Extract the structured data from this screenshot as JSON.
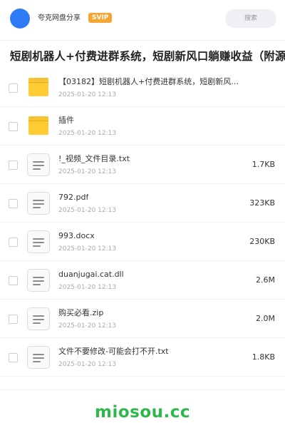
{
  "colors": {
    "accent": "#2f7bf5",
    "badge": "#f7a532",
    "brand_green": "#2cb84a"
  },
  "header": {
    "app_name": "夸克网盘分享",
    "badge": "SVIP",
    "search_placeholder": "搜索"
  },
  "title": "短剧机器人+付费进群系统，短剧新风口躺赚收益（附源码",
  "files": [
    {
      "name": "【03182】短剧机器人+付费进群系统，短剧新风口…",
      "date": "2025-01-20 12:13",
      "size": "",
      "icon": "folder-icon"
    },
    {
      "name": "插件",
      "date": "2025-01-20 12:13",
      "size": "",
      "icon": "folder-icon"
    },
    {
      "name": "!_视频_文件目录.txt",
      "date": "2025-01-20 12:13",
      "size": "1.7KB",
      "icon": "file-icon"
    },
    {
      "name": "792.pdf",
      "date": "2025-01-20 12:13",
      "size": "323KB",
      "icon": "file-icon"
    },
    {
      "name": "993.docx",
      "date": "2025-01-20 12:13",
      "size": "230KB",
      "icon": "file-icon"
    },
    {
      "name": "duanjugai.cat.dll",
      "date": "2025-01-20 12:13",
      "size": "2.6M",
      "icon": "file-icon"
    },
    {
      "name": "购买必看.zip",
      "date": "2025-01-20 12:13",
      "size": "2.0M",
      "icon": "file-icon"
    },
    {
      "name": "文件不要修改-可能会打不开.txt",
      "date": "2025-01-20 12:13",
      "size": "1.8KB",
      "icon": "file-icon"
    }
  ],
  "footer": {
    "logo": "miosou.cc"
  }
}
